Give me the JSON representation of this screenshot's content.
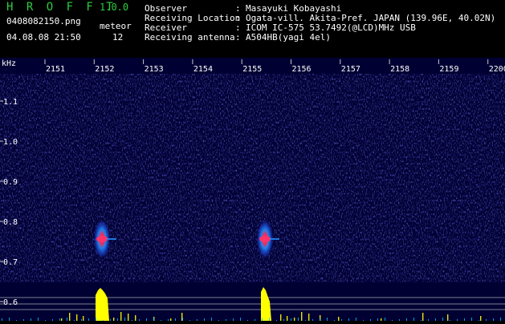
{
  "header": {
    "app_title": "H R O F F T",
    "version": "1.0.0",
    "filename": "0408082150.png",
    "datetime": "04.08.08 21:50",
    "meteor_label": "meteor",
    "meteor_count": "12"
  },
  "metadata": [
    {
      "label": "Observer",
      "value": "Masayuki Kobayashi"
    },
    {
      "label": "Receiving Location",
      "value": "Ogata-vill. Akita-Pref. JAPAN (139.96E, 40.02N)"
    },
    {
      "label": "Receiver",
      "value": "ICOM IC-575 53.7492(@LCD)MHz USB"
    },
    {
      "label": "Receiving antenna",
      "value": "A504HB(yagi 4el)"
    }
  ],
  "spectrogram": {
    "y_unit": "kHz",
    "time_ticks": [
      "2151",
      "2152",
      "2153",
      "2154",
      "2155",
      "2156",
      "2157",
      "2158",
      "2159",
      "2200"
    ],
    "freq_ticks": [
      "1.1",
      "1.0",
      "0.9",
      "0.8",
      "0.7",
      "0.6"
    ],
    "colors": {
      "background": "#000033",
      "noise": "#2a2ad0",
      "meteor_core": "#ff3366",
      "meteor_halo": "#1e90ff",
      "level": "#ffff00",
      "grid": "#c8c8c8",
      "tick_text": "#ffffff"
    }
  }
}
